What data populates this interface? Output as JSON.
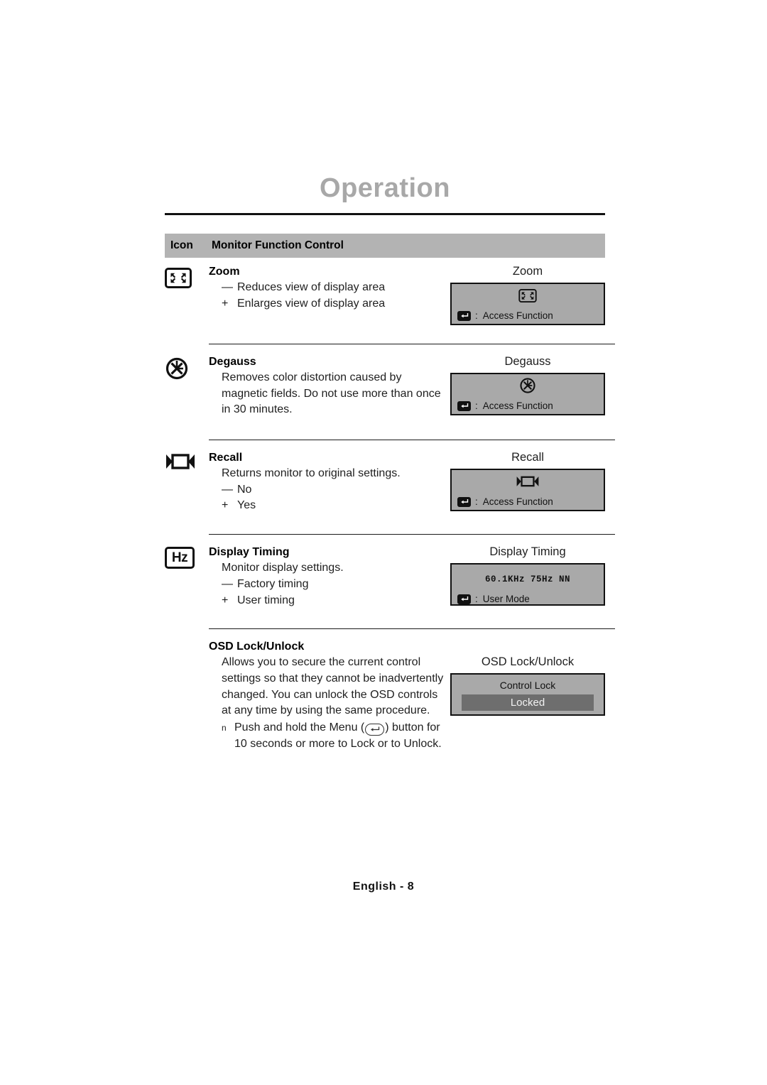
{
  "page": {
    "chapter_title": "Operation",
    "footer": "English - 8"
  },
  "table": {
    "header": {
      "icon_col": "Icon",
      "label_col": "Monitor Function Control"
    },
    "rows": [
      {
        "icon": "zoom-icon",
        "title": "Zoom",
        "options": [
          {
            "sign": "—",
            "text": "Reduces view of display area"
          },
          {
            "sign": "+",
            "text": "Enlarges view of display area"
          }
        ],
        "osd": {
          "caption": "Zoom",
          "symbol": "zoom-icon",
          "key_icon": "enter-key-icon",
          "colon": ":",
          "action": "Access Function"
        }
      },
      {
        "icon": "degauss-icon",
        "title": "Degauss",
        "description": "Removes color distortion caused by magnetic fields. Do not use more than once in 30 minutes.",
        "osd": {
          "caption": "Degauss",
          "symbol": "degauss-icon",
          "key_icon": "enter-key-icon",
          "colon": ":",
          "action": "Access Function"
        }
      },
      {
        "icon": "recall-icon",
        "title": "Recall",
        "description": "Returns monitor to original settings.",
        "options": [
          {
            "sign": "—",
            "text": "No"
          },
          {
            "sign": "+",
            "text": "Yes"
          }
        ],
        "osd": {
          "caption": "Recall",
          "symbol": "recall-icon",
          "key_icon": "enter-key-icon",
          "colon": ":",
          "action": "Access Function"
        }
      },
      {
        "icon": "hz-icon",
        "icon_text": "Hz",
        "title": "Display Timing",
        "description": "Monitor display settings.",
        "options": [
          {
            "sign": "—",
            "text": "Factory timing"
          },
          {
            "sign": "+",
            "text": "User timing"
          }
        ],
        "osd": {
          "caption": "Display Timing",
          "timing_line": "60.1KHz  75Hz  NN",
          "key_icon": "enter-key-icon",
          "colon": ":",
          "action": "User Mode"
        }
      },
      {
        "icon": "none",
        "title": "OSD Lock/Unlock",
        "description": "Allows you to secure the current control settings so that they cannot be inadvertently changed. You can unlock the OSD controls at any time by using the same procedure.",
        "bullet": {
          "marker": "n",
          "before": "Push and hold  the Menu (",
          "key_icon": "menu-key-icon",
          "after": ")",
          "continuation": "button for 10 seconds or more to Lock or to Unlock."
        },
        "osd": {
          "caption": "OSD Lock/Unlock",
          "lock_title": "Control Lock",
          "lock_state": "Locked"
        }
      }
    ]
  },
  "colors": {
    "header_bar": "#b3b3b3",
    "chapter_title": "#a8a8a8",
    "osd_background": "#a9a9a9",
    "osd_highlight": "#6e6e6e",
    "rule": "#111111"
  }
}
